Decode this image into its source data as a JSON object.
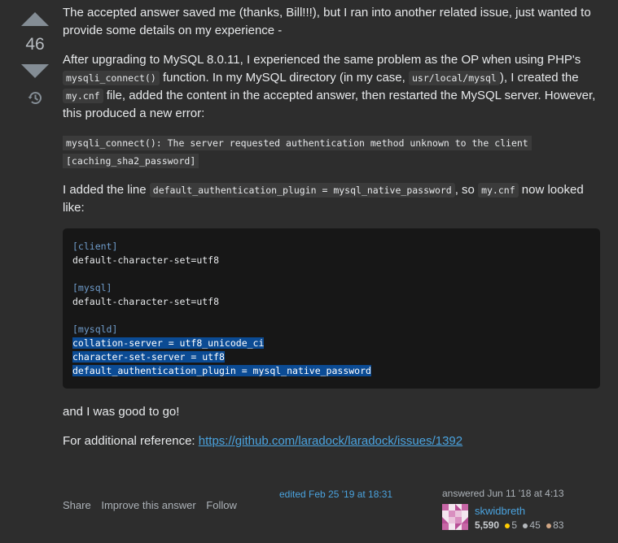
{
  "vote": {
    "count": "46"
  },
  "post": {
    "p1": "The accepted answer saved me (thanks, Bill!!!), but I ran into another related issue, just wanted to provide some details on my experience -",
    "p2": {
      "t1": "After upgrading to MySQL 8.0.11, I experienced the same problem as the OP when using PHP's ",
      "c1": "mysqli_connect()",
      "t2": " function. In my MySQL directory (in my case, ",
      "c2": "usr/local/mysql",
      "t3": "), I created the ",
      "c3": "my.cnf",
      "t4": " file, added the content in the accepted answer, then restarted the MySQL server. However, this produced a new error:"
    },
    "error_line1": "mysqli_connect(): The server requested authentication method unknown to the client",
    "error_line2": "[caching_sha2_password]",
    "p3": {
      "t1": "I added the line ",
      "c1": "default_authentication_plugin = mysql_native_password",
      "t2": ", so ",
      "c2": "my.cnf",
      "t3": " now looked like:"
    },
    "code": {
      "client_header": "[client]",
      "client_line": "default-character-set=utf8",
      "mysql_header": "[mysql]",
      "mysql_line": "default-character-set=utf8",
      "mysqld_header": "[mysqld]",
      "mysqld_l1": "collation-server = utf8_unicode_ci",
      "mysqld_l2": "character-set-server = utf8",
      "mysqld_l3": "default_authentication_plugin = mysql_native_password"
    },
    "p4": "and I was good to go!",
    "p5_prefix": "For additional reference: ",
    "p5_link": "https://github.com/laradock/laradock/issues/1392"
  },
  "footer": {
    "share": "Share",
    "improve": "Improve this answer",
    "follow": "Follow",
    "edited": "edited Feb 25 '19 at 18:31",
    "answered": "answered Jun 11 '18 at 4:13",
    "user_name": "skwidbreth",
    "reputation": "5,590",
    "gold": "5",
    "silver": "45",
    "bronze": "83"
  },
  "colors": {
    "background": "#2d2d2d",
    "link": "#4aa3df",
    "selection": "#0b4b94",
    "code_block_bg": "#171717"
  }
}
